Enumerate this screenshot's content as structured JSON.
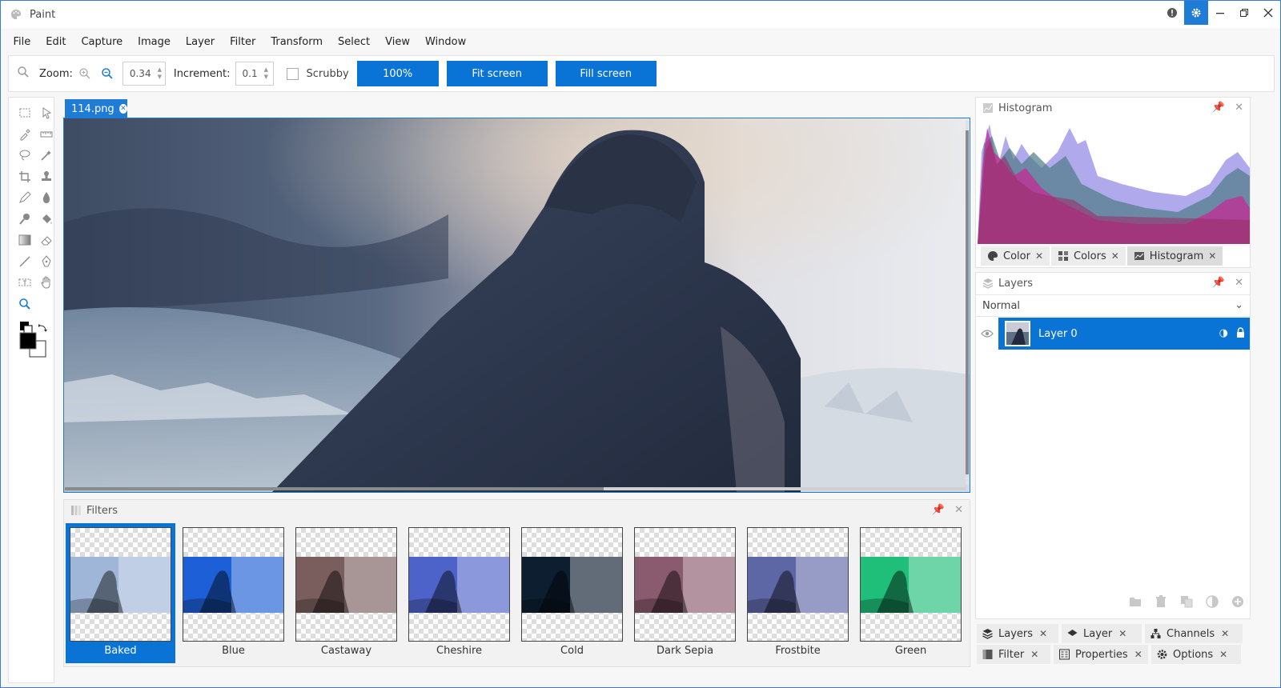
{
  "app": {
    "title": "Paint"
  },
  "menu": [
    "File",
    "Edit",
    "Capture",
    "Image",
    "Layer",
    "Filter",
    "Transform",
    "Select",
    "View",
    "Window"
  ],
  "toolbar": {
    "zoom_label": "Zoom:",
    "zoom_value": "0.34",
    "increment_label": "Increment:",
    "increment_value": "0.1",
    "scrubby_label": "Scrubby",
    "scrubby_checked": false,
    "btn_100": "100%",
    "btn_fit": "Fit screen",
    "btn_fill": "Fill screen"
  },
  "document": {
    "tab_name": "114.png"
  },
  "filters": {
    "title": "Filters",
    "items": [
      {
        "label": "Baked",
        "selected": true,
        "tint": "#9fb6d8"
      },
      {
        "label": "Blue",
        "selected": false,
        "tint": "#1d5fd6"
      },
      {
        "label": "Castaway",
        "selected": false,
        "tint": "#7a5e5e"
      },
      {
        "label": "Cheshire",
        "selected": false,
        "tint": "#4d63c9"
      },
      {
        "label": "Cold",
        "selected": false,
        "tint": "#0d1e30"
      },
      {
        "label": "Dark Sepia",
        "selected": false,
        "tint": "#8a5a6e"
      },
      {
        "label": "Frostbite",
        "selected": false,
        "tint": "#5e67a6"
      },
      {
        "label": "Green",
        "selected": false,
        "tint": "#1fbf7a"
      }
    ]
  },
  "histogram": {
    "title": "Histogram",
    "tabs": [
      {
        "label": "Color",
        "icon": "palette-icon"
      },
      {
        "label": "Colors",
        "icon": "grid-icon"
      },
      {
        "label": "Histogram",
        "icon": "chart-icon",
        "active": true
      }
    ]
  },
  "layers": {
    "title": "Layers",
    "blend_mode": "Normal",
    "items": [
      {
        "name": "Layer 0",
        "visible": true,
        "selected": true
      }
    ]
  },
  "bottom_tabs": {
    "row1": [
      {
        "label": "Layers",
        "icon": "layers-icon"
      },
      {
        "label": "Layer",
        "icon": "layer-icon"
      },
      {
        "label": "Channels",
        "icon": "channels-icon"
      }
    ],
    "row2": [
      {
        "label": "Filter",
        "icon": "filter-icon"
      },
      {
        "label": "Properties",
        "icon": "properties-icon"
      },
      {
        "label": "Options",
        "icon": "options-gear-icon"
      }
    ]
  },
  "colors": {
    "accent": "#0a74d6",
    "primary_color": "#000000",
    "secondary_color": "#ffffff"
  }
}
